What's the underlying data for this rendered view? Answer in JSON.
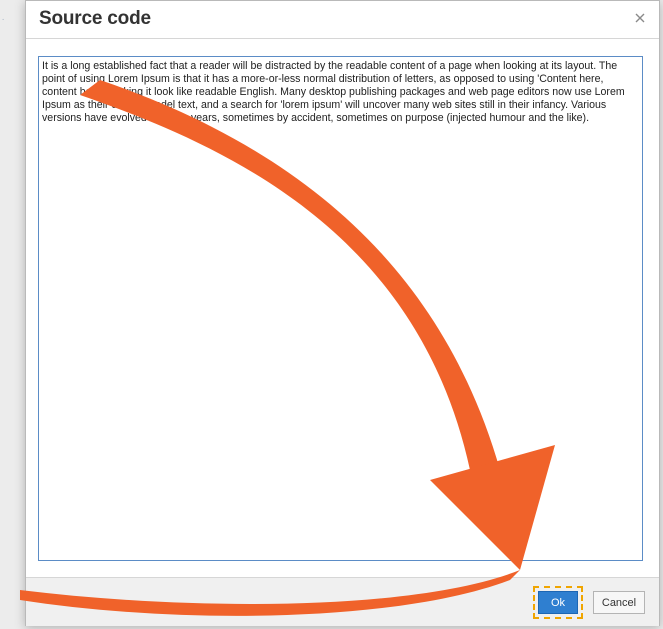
{
  "dialog": {
    "title": "Source code",
    "close_icon": "close-icon",
    "textarea_value": "It is a long established fact that a reader will be distracted by the readable content of a page when looking at its layout. The point of using Lorem Ipsum is that it has a more-or-less normal distribution of letters, as opposed to using 'Content here, content here', making it look like readable English. Many desktop publishing packages and web page editors now use Lorem Ipsum as their default model text, and a search for 'lorem ipsum' will uncover many web sites still in their infancy. Various versions have evolved over the years, sometimes by accident, sometimes on purpose (injected humour and the like).",
    "ok_label": "Ok",
    "cancel_label": "Cancel"
  },
  "overlay": {
    "arrow_color": "#f0622a",
    "focus_outline_color": "#f0a500",
    "accent_color": "#2f7fd0"
  }
}
